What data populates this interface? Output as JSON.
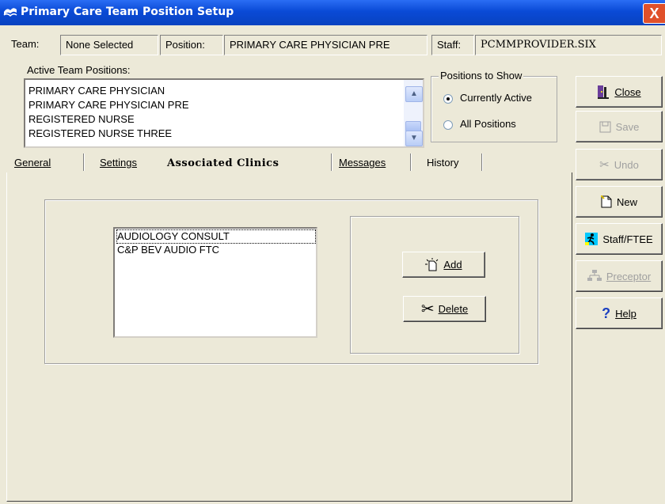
{
  "window": {
    "title": "Primary Care Team Position Setup",
    "close_glyph": "X"
  },
  "infobar": {
    "team_label": "Team:",
    "team_value": "None Selected",
    "position_label": "Position:",
    "position_value": "PRIMARY CARE PHYSICIAN PRE",
    "staff_label": "Staff:",
    "staff_value": "PCMMPROVIDER.SIX"
  },
  "active_positions": {
    "label": "Active Team Positions:",
    "items": [
      "PRIMARY CARE PHYSICIAN",
      "PRIMARY CARE PHYSICIAN PRE",
      "REGISTERED NURSE",
      "REGISTERED NURSE THREE"
    ]
  },
  "positions_to_show": {
    "label": "Positions to Show",
    "options": [
      {
        "label": "Currently Active",
        "selected": true
      },
      {
        "label": "All Positions",
        "selected": false
      }
    ]
  },
  "side_buttons": {
    "close": {
      "label": "Close",
      "icon": "door-exit-icon"
    },
    "save": {
      "label": "Save",
      "icon": "floppy-disk-icon",
      "disabled": true
    },
    "undo": {
      "label": "Undo",
      "icon": "undo-icon",
      "disabled": true
    },
    "new": {
      "label": "New",
      "icon": "new-document-icon"
    },
    "staff": {
      "label": "Staff/FTEE",
      "icon": "running-person-icon"
    },
    "preceptor": {
      "label": "Preceptor",
      "icon": "org-chart-icon",
      "disabled": true
    },
    "help": {
      "label": "Help",
      "icon": "question-mark-icon"
    }
  },
  "tabs": [
    {
      "label": "General",
      "active": false
    },
    {
      "label": "Settings",
      "active": false
    },
    {
      "label": "Associated Clinics",
      "active": true
    },
    {
      "label": "Messages",
      "active": false
    },
    {
      "label": "History",
      "active": false
    }
  ],
  "clinics": {
    "items": [
      "AUDIOLOGY CONSULT",
      "C&P BEV AUDIO FTC"
    ],
    "selected_index": 0
  },
  "clinic_buttons": {
    "add": {
      "label": "Add",
      "icon": "new-item-icon"
    },
    "delete": {
      "label": "Delete",
      "icon": "scissors-icon"
    }
  },
  "colors": {
    "titlebar": "#0a4ad6",
    "face": "#ece9d8",
    "close": "#e0502a"
  }
}
